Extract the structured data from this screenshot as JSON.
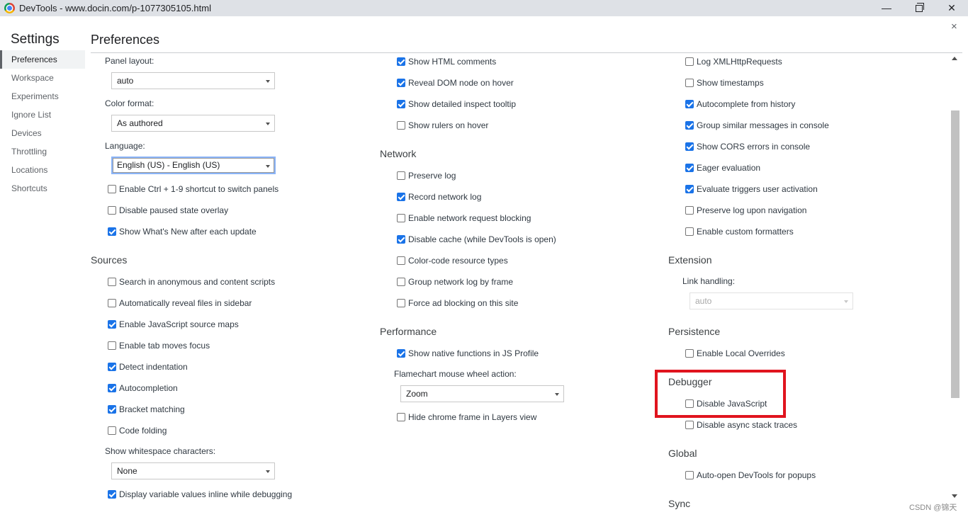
{
  "window": {
    "title": "DevTools - www.docin.com/p-1077305105.html",
    "minimize_glyph": "—",
    "close_glyph": "✕"
  },
  "settings": {
    "title": "Settings",
    "close_glyph": "×"
  },
  "sidebar": {
    "items": [
      {
        "label": "Preferences",
        "active": true
      },
      {
        "label": "Workspace"
      },
      {
        "label": "Experiments"
      },
      {
        "label": "Ignore List"
      },
      {
        "label": "Devices"
      },
      {
        "label": "Throttling"
      },
      {
        "label": "Locations"
      },
      {
        "label": "Shortcuts"
      }
    ]
  },
  "pane": {
    "title": "Preferences"
  },
  "col1": {
    "panel_layout": {
      "label": "Panel layout:",
      "value": "auto"
    },
    "color_format": {
      "label": "Color format:",
      "value": "As authored"
    },
    "language": {
      "label": "Language:",
      "value": "English (US) - English (US)"
    },
    "checks": [
      {
        "label": "Enable Ctrl + 1-9 shortcut to switch panels",
        "checked": false
      },
      {
        "label": "Disable paused state overlay",
        "checked": false
      },
      {
        "label": "Show What's New after each update",
        "checked": true
      }
    ],
    "sources_header": "Sources",
    "sources_checks": [
      {
        "label": "Search in anonymous and content scripts",
        "checked": false
      },
      {
        "label": "Automatically reveal files in sidebar",
        "checked": false
      },
      {
        "label": "Enable JavaScript source maps",
        "checked": true
      },
      {
        "label": "Enable tab moves focus",
        "checked": false
      },
      {
        "label": "Detect indentation",
        "checked": true
      },
      {
        "label": "Autocompletion",
        "checked": true
      },
      {
        "label": "Bracket matching",
        "checked": true
      },
      {
        "label": "Code folding",
        "checked": false
      }
    ],
    "whitespace": {
      "label": "Show whitespace characters:",
      "value": "None"
    },
    "inline_values": {
      "label": "Display variable values inline while debugging",
      "checked": true
    }
  },
  "col2": {
    "elements_checks": [
      {
        "label": "Show HTML comments",
        "checked": true
      },
      {
        "label": "Reveal DOM node on hover",
        "checked": true
      },
      {
        "label": "Show detailed inspect tooltip",
        "checked": true
      },
      {
        "label": "Show rulers on hover",
        "checked": false
      }
    ],
    "network_header": "Network",
    "network_checks": [
      {
        "label": "Preserve log",
        "checked": false
      },
      {
        "label": "Record network log",
        "checked": true
      },
      {
        "label": "Enable network request blocking",
        "checked": false
      },
      {
        "label": "Disable cache (while DevTools is open)",
        "checked": true
      },
      {
        "label": "Color-code resource types",
        "checked": false
      },
      {
        "label": "Group network log by frame",
        "checked": false
      },
      {
        "label": "Force ad blocking on this site",
        "checked": false
      }
    ],
    "performance_header": "Performance",
    "native_functions": {
      "label": "Show native functions in JS Profile",
      "checked": true
    },
    "flamechart": {
      "label": "Flamechart mouse wheel action:",
      "value": "Zoom"
    },
    "hide_chrome_frame": {
      "label": "Hide chrome frame in Layers view",
      "checked": false
    }
  },
  "col3": {
    "console_checks": [
      {
        "label": "Log XMLHttpRequests",
        "checked": false
      },
      {
        "label": "Show timestamps",
        "checked": false
      },
      {
        "label": "Autocomplete from history",
        "checked": true
      },
      {
        "label": "Group similar messages in console",
        "checked": true
      },
      {
        "label": "Show CORS errors in console",
        "checked": true
      },
      {
        "label": "Eager evaluation",
        "checked": true
      },
      {
        "label": "Evaluate triggers user activation",
        "checked": true
      },
      {
        "label": "Preserve log upon navigation",
        "checked": false
      },
      {
        "label": "Enable custom formatters",
        "checked": false
      }
    ],
    "extension_header": "Extension",
    "link_handling": {
      "label": "Link handling:",
      "value": "auto"
    },
    "persistence_header": "Persistence",
    "local_overrides": {
      "label": "Enable Local Overrides",
      "checked": false
    },
    "debugger_header": "Debugger",
    "disable_js": {
      "label": "Disable JavaScript",
      "checked": false
    },
    "disable_async": {
      "label": "Disable async stack traces",
      "checked": false
    },
    "global_header": "Global",
    "auto_open": {
      "label": "Auto-open DevTools for popups",
      "checked": false
    },
    "sync_header": "Sync"
  },
  "annotation": {
    "color": "#e0141e"
  },
  "watermark": "CSDN @锦天"
}
